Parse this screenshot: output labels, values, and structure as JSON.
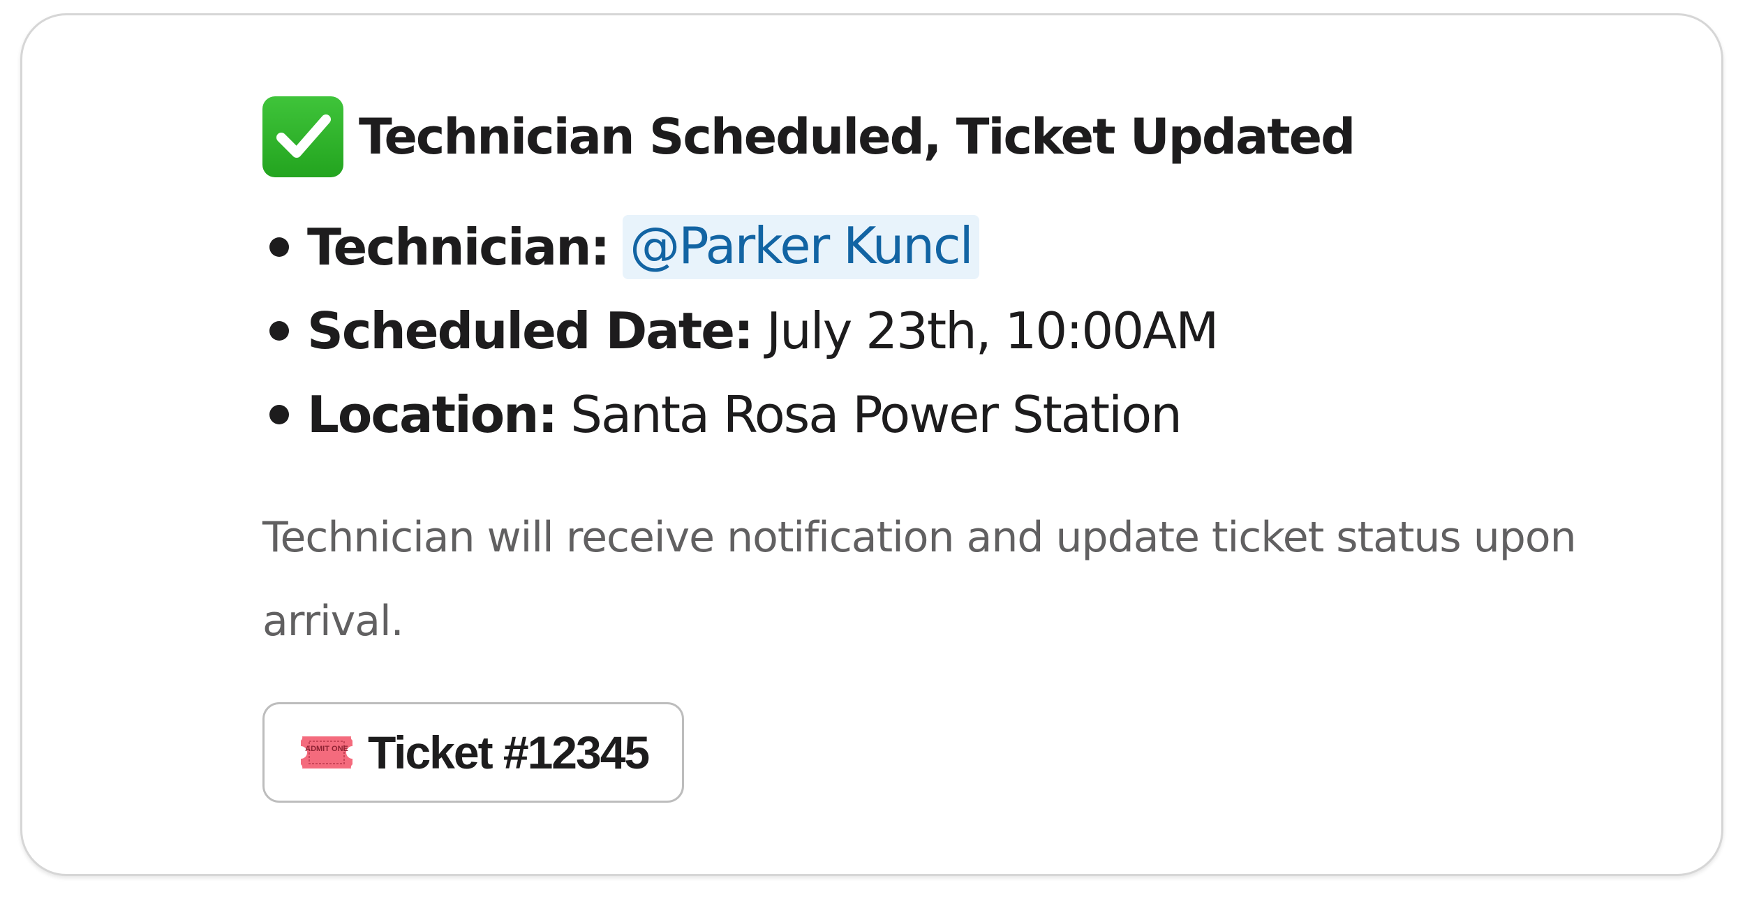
{
  "message": {
    "title": "Technician Scheduled, Ticket Updated",
    "title_icon": "check-mark-button-icon",
    "details": [
      {
        "label": "Technician:",
        "value": "@Parker Kuncl",
        "type": "mention"
      },
      {
        "label": "Scheduled Date:",
        "value": "July 23th, 10:00AM",
        "type": "text"
      },
      {
        "label": "Location:",
        "value": "Santa Rosa Power Station",
        "type": "text"
      }
    ],
    "note": "Technician will receive notification and update ticket status upon arrival.",
    "ticket_button": {
      "label": "Ticket #12345",
      "icon": "admission-ticket-icon",
      "icon_text": "ADMIT ONE"
    }
  },
  "colors": {
    "check_green": "#2fb42a",
    "mention_text": "#1264a3",
    "mention_background": "#e8f3fb",
    "ticket_pink": "#f46b7d",
    "text_primary": "#1d1c1d",
    "text_secondary": "#616061"
  }
}
